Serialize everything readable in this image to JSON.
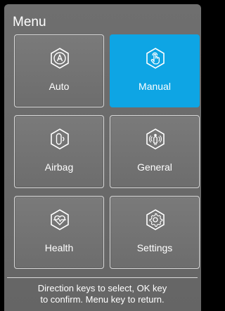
{
  "menu": {
    "title": "Menu",
    "items": [
      {
        "label": "Auto",
        "icon": "auto-mode-icon",
        "selected": false
      },
      {
        "label": "Manual",
        "icon": "hand-touch-icon",
        "selected": true
      },
      {
        "label": "Airbag",
        "icon": "airbag-icon",
        "selected": false
      },
      {
        "label": "General",
        "icon": "person-signal-icon",
        "selected": false
      },
      {
        "label": "Health",
        "icon": "heart-pulse-icon",
        "selected": false
      },
      {
        "label": "Settings",
        "icon": "gear-icon",
        "selected": false
      }
    ]
  },
  "footer": {
    "hint_line1": "Direction keys to select, OK key",
    "hint_line2": "to confirm. Menu key to return."
  },
  "colors": {
    "background": "#000000",
    "panel": "#6a6a6a",
    "tile": "#747474",
    "tile_border": "#d8d8d8",
    "selected": "#0ea5e4",
    "text": "#ffffff"
  }
}
